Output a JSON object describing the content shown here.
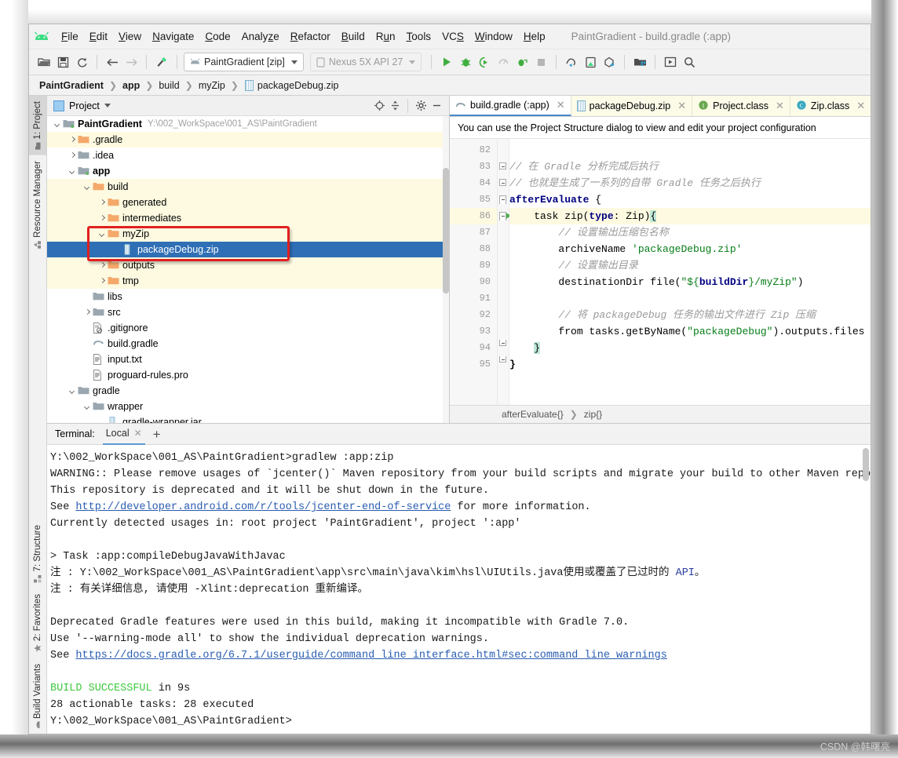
{
  "window": {
    "title": "PaintGradient - build.gradle (:app)"
  },
  "menu": [
    {
      "label": "File",
      "mnemonic": "F"
    },
    {
      "label": "Edit",
      "mnemonic": "E"
    },
    {
      "label": "View",
      "mnemonic": "V"
    },
    {
      "label": "Navigate",
      "mnemonic": "N"
    },
    {
      "label": "Code",
      "mnemonic": "C"
    },
    {
      "label": "Analyze",
      "mnemonic": "z"
    },
    {
      "label": "Refactor",
      "mnemonic": "R"
    },
    {
      "label": "Build",
      "mnemonic": "B"
    },
    {
      "label": "Run",
      "mnemonic": "u"
    },
    {
      "label": "Tools",
      "mnemonic": "T"
    },
    {
      "label": "VCS",
      "mnemonic": "S"
    },
    {
      "label": "Window",
      "mnemonic": "W"
    },
    {
      "label": "Help",
      "mnemonic": "H"
    }
  ],
  "toolbar": {
    "run_config": "PaintGradient [zip]",
    "device": "Nexus 5X API 27",
    "icons": [
      "open-folder-icon",
      "save-all-icon",
      "sync-icon",
      "back-arrow-icon",
      "forward-arrow-icon",
      "build-hammer-icon"
    ],
    "right_icons": [
      "run-icon",
      "debug-icon",
      "run-with-coverage-icon",
      "profile-icon",
      "attach-debugger-icon",
      "stop-icon",
      "sdk-manager-icon",
      "avd-manager-icon",
      "sync-project-icon",
      "project-structure-icon",
      "device-file-explorer-icon",
      "search-everywhere-icon"
    ]
  },
  "breadcrumb": [
    {
      "label": "PaintGradient",
      "bold": true
    },
    {
      "label": "app",
      "bold": true
    },
    {
      "label": "build",
      "bold": false
    },
    {
      "label": "myZip",
      "bold": false
    },
    {
      "label": "packageDebug.zip",
      "bold": false,
      "icon": "zip-file-icon"
    }
  ],
  "left_strip": {
    "top": [
      {
        "label": "1: Project",
        "icon": "project-icon",
        "active": true
      },
      {
        "label": "Resource Manager",
        "icon": "resource-manager-icon",
        "active": false
      }
    ],
    "bottom": [
      {
        "label": "7: Structure",
        "icon": "structure-icon",
        "active": false
      },
      {
        "label": "2: Favorites",
        "icon": "star-icon",
        "active": false
      },
      {
        "label": "Build Variants",
        "icon": "android-icon",
        "active": false
      }
    ]
  },
  "project_panel": {
    "title": "Project",
    "toolbar_icons": [
      "locate-target-icon",
      "collapse-all-icon",
      "settings-gear-icon",
      "hide-minus-icon"
    ],
    "tree": [
      {
        "indent": 0,
        "arrow": "down",
        "icon": "module-folder-icon",
        "label": "PaintGradient",
        "bold": true,
        "path": "Y:\\002_WorkSpace\\001_AS\\PaintGradient",
        "state": "normal"
      },
      {
        "indent": 1,
        "arrow": "right",
        "icon": "orange-folder-icon",
        "label": ".gradle",
        "bold": false,
        "path": "",
        "state": "highlight"
      },
      {
        "indent": 1,
        "arrow": "right",
        "icon": "gray-folder-icon",
        "label": ".idea",
        "bold": false,
        "path": "",
        "state": "normal"
      },
      {
        "indent": 1,
        "arrow": "down",
        "icon": "module-folder-icon",
        "label": "app",
        "bold": true,
        "path": "",
        "state": "normal"
      },
      {
        "indent": 2,
        "arrow": "down",
        "icon": "orange-folder-icon",
        "label": "build",
        "bold": false,
        "path": "",
        "state": "highlight"
      },
      {
        "indent": 3,
        "arrow": "right",
        "icon": "orange-folder-icon",
        "label": "generated",
        "bold": false,
        "path": "",
        "state": "highlight"
      },
      {
        "indent": 3,
        "arrow": "right",
        "icon": "orange-folder-icon",
        "label": "intermediates",
        "bold": false,
        "path": "",
        "state": "highlight"
      },
      {
        "indent": 3,
        "arrow": "down",
        "icon": "orange-folder-icon",
        "label": "myZip",
        "bold": false,
        "path": "",
        "state": "highlight"
      },
      {
        "indent": 4,
        "arrow": "none",
        "icon": "zip-file-icon",
        "label": "packageDebug.zip",
        "bold": false,
        "path": "",
        "state": "selected"
      },
      {
        "indent": 3,
        "arrow": "right",
        "icon": "orange-folder-icon",
        "label": "outputs",
        "bold": false,
        "path": "",
        "state": "highlight"
      },
      {
        "indent": 3,
        "arrow": "right",
        "icon": "orange-folder-icon",
        "label": "tmp",
        "bold": false,
        "path": "",
        "state": "highlight"
      },
      {
        "indent": 2,
        "arrow": "none",
        "icon": "gray-folder-icon",
        "label": "libs",
        "bold": false,
        "path": "",
        "state": "normal"
      },
      {
        "indent": 2,
        "arrow": "right",
        "icon": "gray-folder-icon",
        "label": "src",
        "bold": false,
        "path": "",
        "state": "normal"
      },
      {
        "indent": 2,
        "arrow": "none",
        "icon": "gitignore-file-icon",
        "label": ".gitignore",
        "bold": false,
        "path": "",
        "state": "normal"
      },
      {
        "indent": 2,
        "arrow": "none",
        "icon": "gradle-file-icon",
        "label": "build.gradle",
        "bold": false,
        "path": "",
        "state": "normal"
      },
      {
        "indent": 2,
        "arrow": "none",
        "icon": "text-file-icon",
        "label": "input.txt",
        "bold": false,
        "path": "",
        "state": "normal"
      },
      {
        "indent": 2,
        "arrow": "none",
        "icon": "text-file-icon",
        "label": "proguard-rules.pro",
        "bold": false,
        "path": "",
        "state": "normal"
      },
      {
        "indent": 1,
        "arrow": "down",
        "icon": "gray-folder-icon",
        "label": "gradle",
        "bold": false,
        "path": "",
        "state": "normal"
      },
      {
        "indent": 2,
        "arrow": "down",
        "icon": "gray-folder-icon",
        "label": "wrapper",
        "bold": false,
        "path": "",
        "state": "normal"
      },
      {
        "indent": 3,
        "arrow": "none",
        "icon": "jar-file-icon",
        "label": "gradle-wrapper.jar",
        "bold": false,
        "path": "",
        "state": "normal"
      }
    ]
  },
  "editor": {
    "tabs": [
      {
        "label": "build.gradle (:app)",
        "icon": "gradle-file-icon",
        "active": true
      },
      {
        "label": "packageDebug.zip",
        "icon": "zip-file-icon",
        "active": false
      },
      {
        "label": "Project.class",
        "icon": "interface-icon",
        "active": false
      },
      {
        "label": "Zip.class",
        "icon": "class-icon",
        "active": false
      }
    ],
    "notification": "You can use the Project Structure dialog to view and edit your project configuration",
    "first_line": 82,
    "lines": [
      {
        "num": 82,
        "text": ""
      },
      {
        "num": 83,
        "text": "// 在 Gradle 分析完成后执行"
      },
      {
        "num": 84,
        "text": "// 也就是生成了一系列的自带 Gradle 任务之后执行"
      },
      {
        "num": 85,
        "text": "afterEvaluate {"
      },
      {
        "num": 86,
        "text": "    task zip(type: Zip){"
      },
      {
        "num": 87,
        "text": "        // 设置输出压缩包名称"
      },
      {
        "num": 88,
        "text": "        archiveName 'packageDebug.zip'"
      },
      {
        "num": 89,
        "text": "        // 设置输出目录"
      },
      {
        "num": 90,
        "text": "        destinationDir file(\"${buildDir}/myZip\")"
      },
      {
        "num": 91,
        "text": ""
      },
      {
        "num": 92,
        "text": "        // 将 packageDebug 任务的输出文件进行 Zip 压缩"
      },
      {
        "num": 93,
        "text": "        from tasks.getByName(\"packageDebug\").outputs.files"
      },
      {
        "num": 94,
        "text": "    }"
      },
      {
        "num": 95,
        "text": "}"
      }
    ],
    "highlight_line": 86,
    "structure_crumb": [
      "afterEvaluate{}",
      "zip{}"
    ]
  },
  "terminal": {
    "label": "Terminal:",
    "tab": "Local",
    "add_button": "+",
    "lines": [
      {
        "kind": "plain",
        "text": "Y:\\002_WorkSpace\\001_AS\\PaintGradient>gradlew :app:zip"
      },
      {
        "kind": "plain",
        "text": "WARNING:: Please remove usages of `jcenter()` Maven repository from your build scripts and migrate your build to other Maven reposi"
      },
      {
        "kind": "plain",
        "text": "This repository is deprecated and it will be shut down in the future."
      },
      {
        "kind": "link-mid",
        "pre": "See ",
        "link": "http://developer.android.com/r/tools/jcenter-end-of-service",
        "post": " for more information."
      },
      {
        "kind": "plain",
        "text": "Currently detected usages in: root project 'PaintGradient', project ':app'"
      },
      {
        "kind": "blank",
        "text": ""
      },
      {
        "kind": "plain",
        "text": "> Task :app:compileDebugJavaWithJavac"
      },
      {
        "kind": "api",
        "pre": "注 : Y:\\002_WorkSpace\\001_AS\\PaintGradient\\app\\src\\main\\java\\kim\\hsl\\UIUtils.java使用或覆盖了已过时的 ",
        "api": "API",
        "post": "。"
      },
      {
        "kind": "plain",
        "text": "注 : 有关详细信息, 请使用 -Xlint:deprecation 重新编译。"
      },
      {
        "kind": "blank",
        "text": ""
      },
      {
        "kind": "plain",
        "text": "Deprecated Gradle features were used in this build, making it incompatible with Gradle 7.0."
      },
      {
        "kind": "plain",
        "text": "Use '--warning-mode all' to show the individual deprecation warnings."
      },
      {
        "kind": "link-mid",
        "pre": "See ",
        "link": "https://docs.gradle.org/6.7.1/userguide/command_line_interface.html#sec:command_line_warnings",
        "post": ""
      },
      {
        "kind": "blank",
        "text": ""
      },
      {
        "kind": "success",
        "green": "BUILD SUCCESSFUL",
        "rest": " in 9s"
      },
      {
        "kind": "plain",
        "text": "28 actionable tasks: 28 executed"
      },
      {
        "kind": "plain",
        "text": "Y:\\002_WorkSpace\\001_AS\\PaintGradient>"
      }
    ]
  },
  "watermark": "CSDN @韩曙亮",
  "colors": {
    "selection_blue": "#2f6fb5",
    "highlight_yellow": "#fdfae1",
    "annotation_red": "#e02020",
    "link_blue": "#2a5db0",
    "success_green": "#3ec93e",
    "accent_green": "#4caf50"
  }
}
